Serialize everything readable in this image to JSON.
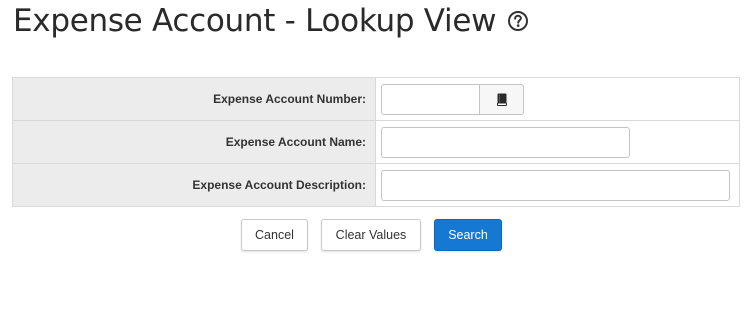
{
  "page": {
    "title": "Expense Account - Lookup View",
    "help_icon": "question-circle-icon"
  },
  "form": {
    "fields": [
      {
        "label": "Expense Account Number:",
        "value": "",
        "lookup_icon": "book-icon"
      },
      {
        "label": "Expense Account Name:",
        "value": ""
      },
      {
        "label": "Expense Account Description:",
        "value": ""
      }
    ]
  },
  "actions": {
    "cancel_label": "Cancel",
    "clear_label": "Clear Values",
    "search_label": "Search"
  },
  "colors": {
    "label_background": "#ececec",
    "primary_button": "#1579d4",
    "border": "#d9d9d9"
  }
}
